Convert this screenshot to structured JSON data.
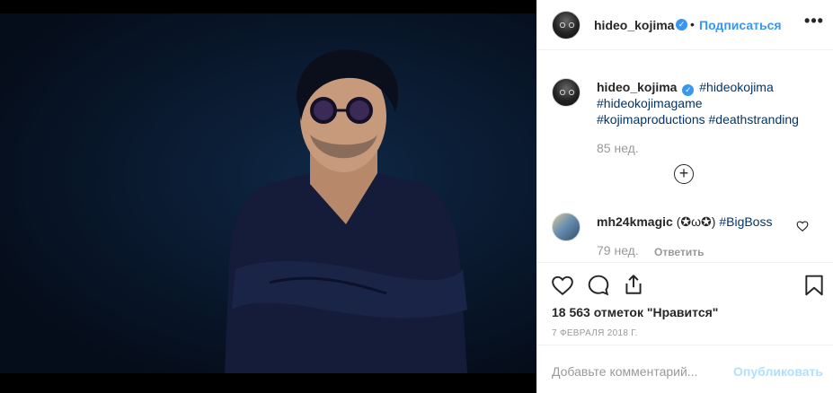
{
  "post": {
    "author": "hideo_kojima",
    "follow_label": "Подписаться",
    "separator": "•",
    "more_label": "•••"
  },
  "caption": {
    "author": "hideo_kojima",
    "tags": [
      "#hideokojima",
      "#hideokojimagame",
      "#kojimaproductions",
      "#deathstranding"
    ],
    "time": "85 нед.",
    "load_more": "+"
  },
  "comment": {
    "author": "mh24kmagic",
    "text": "(✪ω✪)",
    "tag": "#BigBoss",
    "time": "79 нед.",
    "reply_label": "Ответить"
  },
  "actions": {
    "likes": "18 563 отметок \"Нравится\"",
    "date": "7 ФЕВРАЛЯ 2018 Г."
  },
  "add_comment": {
    "placeholder": "Добавьте комментарий...",
    "publish_label": "Опубликовать"
  },
  "colors": {
    "accent": "#3897f0",
    "tag": "#003569",
    "muted": "#999999",
    "publish_disabled": "#b2dffc",
    "photo_bg": "#050d1a"
  },
  "icons": {
    "verified": "verified-badge-icon",
    "like": "heart-icon",
    "comment": "comment-bubble-icon",
    "share": "share-icon",
    "save": "bookmark-icon",
    "load_more": "plus-circle-icon"
  }
}
